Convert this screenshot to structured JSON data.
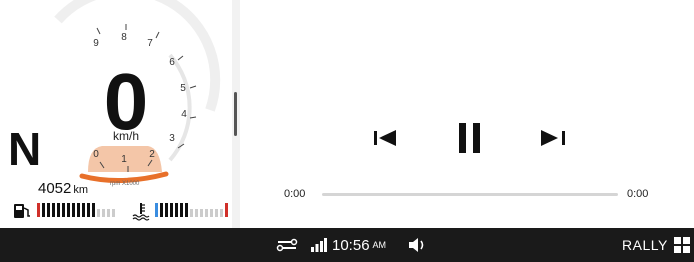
{
  "dashboard": {
    "gear": "N",
    "speed": "0",
    "speed_unit": "km/h",
    "odometer": "4052",
    "odometer_unit": "km",
    "rpm_unit": "rpm X1000",
    "rpm_labels": [
      "0",
      "1",
      "2",
      "3",
      "4",
      "5",
      "6",
      "7",
      "8",
      "9"
    ],
    "fuel_level_fraction": 0.8,
    "temp_level_fraction": 0.45
  },
  "media": {
    "current_time": "0:00",
    "total_time": "0:00",
    "progress_fraction": 0,
    "controls": [
      "prev-icon",
      "pause-icon",
      "next-icon"
    ]
  },
  "statusbar": {
    "time": "10:56",
    "ampm": "AM",
    "mode": "RALLY",
    "icons": [
      "connection-icon",
      "signal-icon",
      "volume-icon",
      "grid-icon"
    ]
  },
  "colors": {
    "accent": "#e8702a",
    "rpm_zone": "#f4c6a8",
    "bar_bg": "#1a1a1a",
    "red": "#d0302a",
    "blue": "#3a8de0"
  }
}
